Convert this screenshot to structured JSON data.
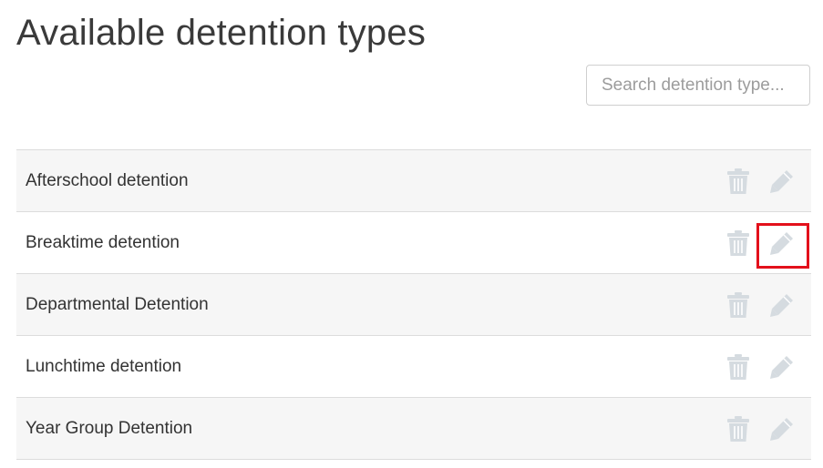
{
  "page": {
    "title": "Available detention types"
  },
  "search": {
    "placeholder": "Search detention type..."
  },
  "colors": {
    "icon": "#d5dbe0",
    "highlight": "#e3101b",
    "row_alt_background": "#f6f6f6"
  },
  "icons": {
    "delete": "trash-icon",
    "edit": "pencil-icon"
  },
  "detention_types": [
    {
      "label": "Afterschool detention",
      "edit_highlighted": false
    },
    {
      "label": "Breaktime detention",
      "edit_highlighted": true
    },
    {
      "label": "Departmental Detention",
      "edit_highlighted": false
    },
    {
      "label": "Lunchtime detention",
      "edit_highlighted": false
    },
    {
      "label": "Year Group Detention",
      "edit_highlighted": false
    }
  ]
}
